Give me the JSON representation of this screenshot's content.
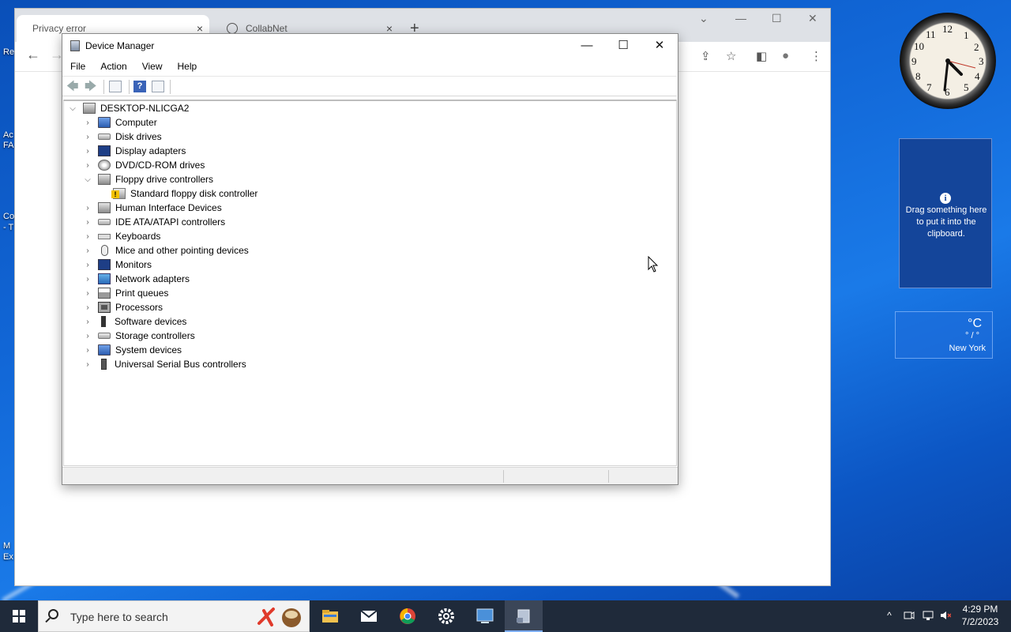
{
  "desktop": {
    "left_fragments": [
      "Re",
      "Ac",
      "FA",
      "Co",
      "- T",
      "M",
      "Ex"
    ]
  },
  "chrome": {
    "tabs": [
      {
        "label": "Privacy error",
        "close": "×"
      },
      {
        "label": "CollabNet",
        "close": "×"
      }
    ],
    "new_tab": "+",
    "window_controls": {
      "minimize": "⌄",
      "min": "—",
      "max": "☐",
      "close": "✕"
    },
    "toolbar": {
      "back": "←",
      "forward": "→",
      "share": "⇪",
      "star": "☆",
      "sidebar": "◧",
      "profile": "●",
      "menu": "⋮"
    }
  },
  "device_manager": {
    "title": "Device Manager",
    "controls": {
      "minimize": "—",
      "maximize": "☐",
      "close": "✕"
    },
    "menu": [
      "File",
      "Action",
      "View",
      "Help"
    ],
    "toolbar": {
      "back": "🡄",
      "forward": "🡆",
      "help": "?"
    },
    "root": "DESKTOP-NLICGA2",
    "categories": [
      "Computer",
      "Disk drives",
      "Display adapters",
      "DVD/CD-ROM drives",
      "Floppy drive controllers",
      "Standard floppy disk controller",
      "Human Interface Devices",
      "IDE ATA/ATAPI controllers",
      "Keyboards",
      "Mice and other pointing devices",
      "Monitors",
      "Network adapters",
      "Print queues",
      "Processors",
      "Software devices",
      "Storage controllers",
      "System devices",
      "Universal Serial Bus controllers"
    ]
  },
  "gadgets": {
    "clock_numbers": [
      "12",
      "1",
      "2",
      "3",
      "4",
      "5",
      "6",
      "7",
      "8",
      "9",
      "10",
      "11"
    ],
    "clipboard": {
      "icon": "i",
      "message": "Drag something here to put it into the clipboard."
    },
    "weather": {
      "unit": "°C",
      "hilo": "° / °",
      "city": "New York"
    }
  },
  "taskbar": {
    "search_placeholder": "Type here to search",
    "apps": [
      "file-explorer",
      "mail",
      "chrome",
      "settings",
      "remote-desktop",
      "device-manager"
    ],
    "tray": {
      "chevron": "^",
      "time": "4:29 PM",
      "date": "7/2/2023"
    }
  }
}
